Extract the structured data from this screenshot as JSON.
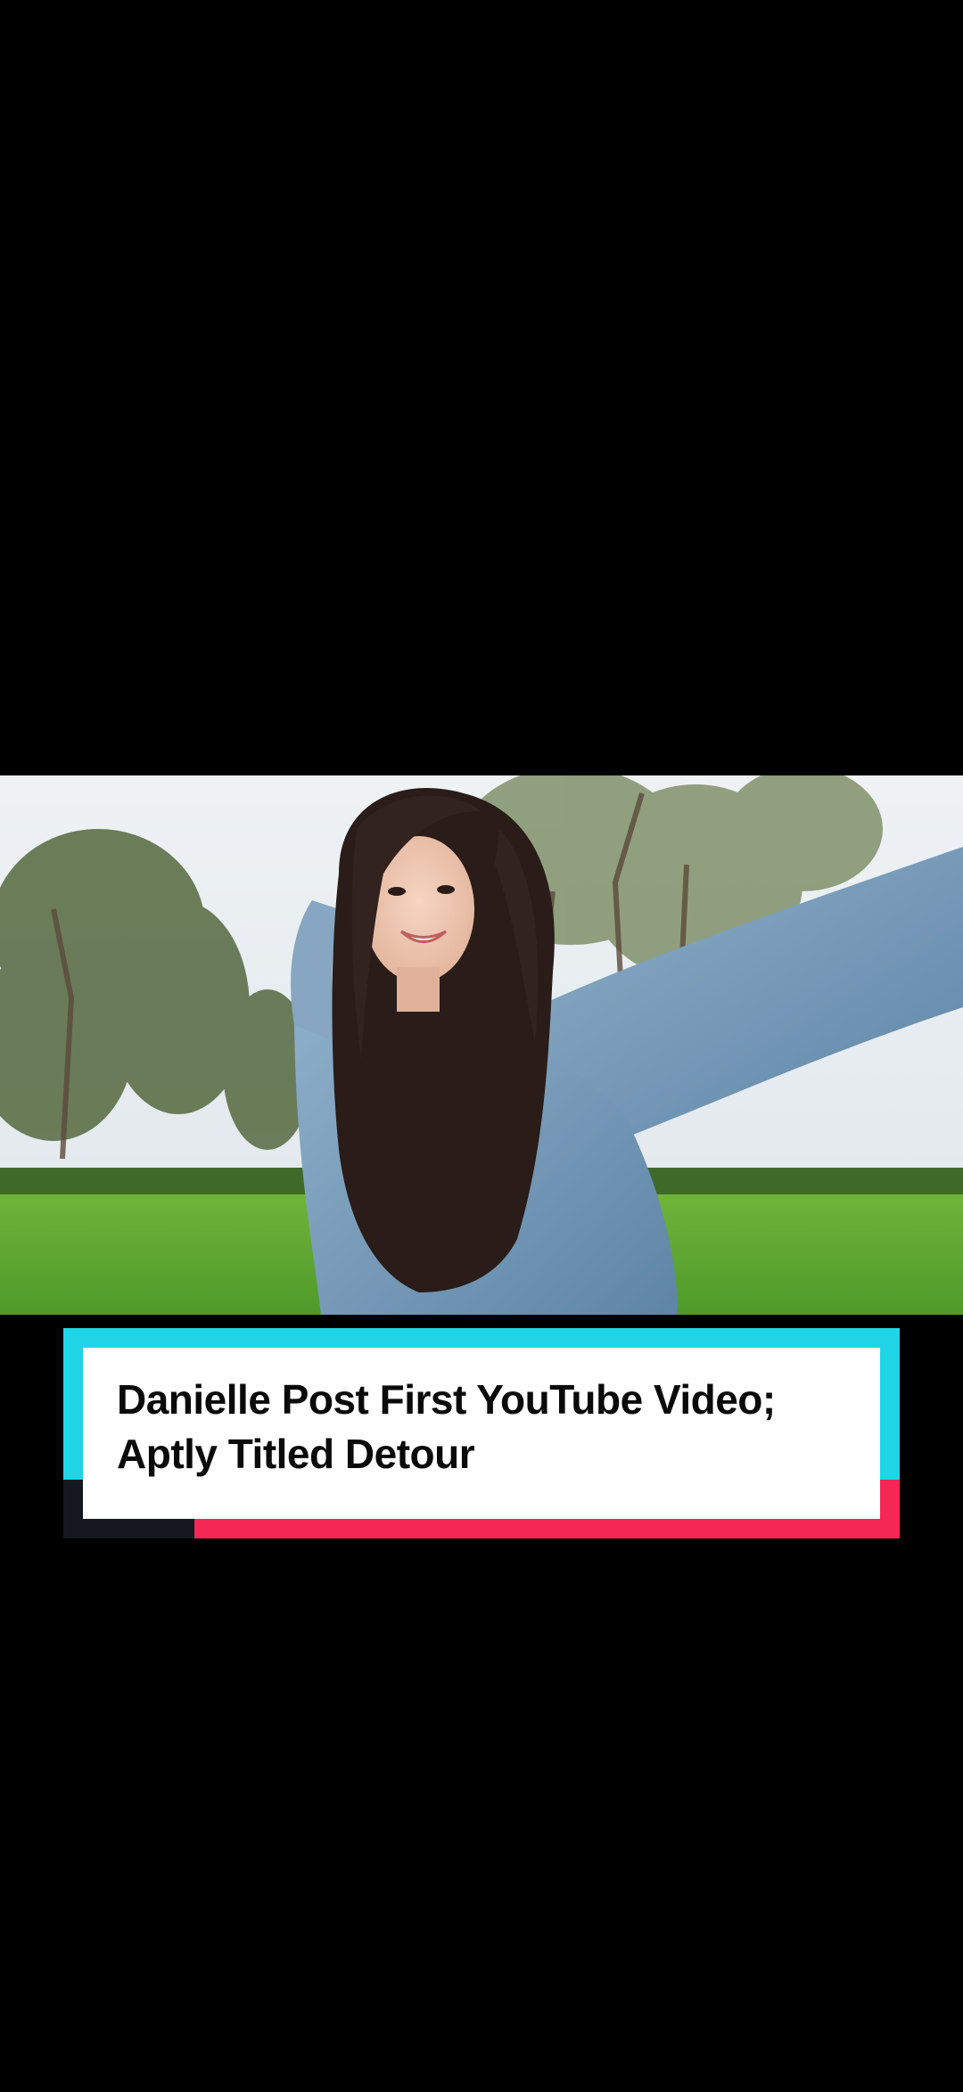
{
  "caption": {
    "line1": "Danielle Post First YouTube Video;",
    "line2": "Aptly Titled Detour"
  },
  "colors": {
    "background": "#000000",
    "accent_cyan": "#1fd5e6",
    "accent_red": "#f52855",
    "accent_dark": "#15181f",
    "caption_bg": "#ffffff"
  }
}
